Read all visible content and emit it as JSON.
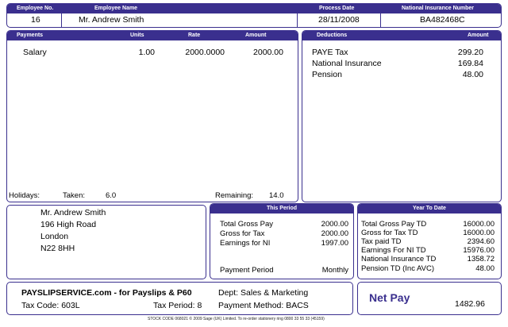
{
  "header": {
    "employee_no_label": "Employee No.",
    "employee_no": "16",
    "employee_name_label": "Employee Name",
    "employee_name": "Mr. Andrew Smith",
    "process_date_label": "Process Date",
    "process_date": "28/11/2008",
    "ni_number_label": "National Insurance Number",
    "ni_number": "BA482468C"
  },
  "payments": {
    "headers": {
      "payments": "Payments",
      "units": "Units",
      "rate": "Rate",
      "amount": "Amount"
    },
    "rows": [
      {
        "description": "Salary",
        "units": "1.00",
        "rate": "2000.0000",
        "amount": "2000.00"
      }
    ],
    "holidays_label": "Holidays:",
    "taken_label": "Taken:",
    "taken": "6.0",
    "remaining_label": "Remaining:",
    "remaining": "14.0"
  },
  "deductions": {
    "headers": {
      "deductions": "Deductions",
      "amount": "Amount"
    },
    "rows": [
      {
        "description": "PAYE Tax",
        "amount": "299.20"
      },
      {
        "description": "National Insurance",
        "amount": "169.84"
      },
      {
        "description": "Pension",
        "amount": "48.00"
      }
    ]
  },
  "address": {
    "lines": [
      "Mr. Andrew Smith",
      "196 High Road",
      "London",
      "N22 8HH"
    ]
  },
  "this_period": {
    "title": "This Period",
    "rows": [
      {
        "label": "Total Gross Pay",
        "value": "2000.00"
      },
      {
        "label": "Gross for Tax",
        "value": "2000.00"
      },
      {
        "label": "Earnings for NI",
        "value": "1997.00"
      }
    ],
    "payment_period_label": "Payment Period",
    "payment_period": "Monthly"
  },
  "year_to_date": {
    "title": "Year To Date",
    "rows": [
      {
        "label": "Total Gross Pay TD",
        "value": "16000.00"
      },
      {
        "label": "Gross for Tax TD",
        "value": "16000.00"
      },
      {
        "label": "Tax paid TD",
        "value": "2394.60"
      },
      {
        "label": "Earnings For NI TD",
        "value": "15976.00"
      },
      {
        "label": "National Insurance TD",
        "value": "1358.72"
      },
      {
        "label": "Pension TD (Inc AVC)",
        "value": "48.00"
      }
    ]
  },
  "footer": {
    "service": "PAYSLIPSERVICE.com - for Payslips & P60",
    "tax_code": "Tax Code: 603L",
    "tax_period": "Tax Period: 8",
    "dept": "Dept: Sales & Marketing",
    "payment_method": "Payment Method: BACS",
    "net_pay_label": "Net Pay",
    "net_pay": "1482.96",
    "stock_code": "STOCK CODE 068021 © 2009 Sage (UK) Limited. To re-order stationery ring 0800 33 55 33   (45159)"
  },
  "colors": {
    "accent": "#3a2f8e",
    "net_pay_text": "#3a2f8e"
  }
}
